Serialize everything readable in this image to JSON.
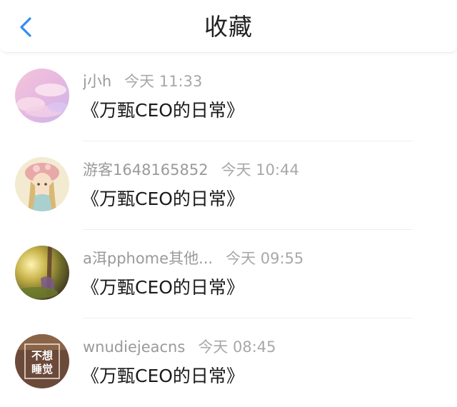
{
  "header": {
    "title": "收藏",
    "back_icon": "chevron-left-icon",
    "accent_color": "#2f8ff0"
  },
  "items": [
    {
      "name": "j小h",
      "time": "今天 11:33",
      "content": "《万甄CEO的日常》",
      "avatar": "pink-clouds-avatar"
    },
    {
      "name": "游客1648165852",
      "time": "今天 10:44",
      "content": "《万甄CEO的日常》",
      "avatar": "anime-girl-avatar"
    },
    {
      "name": "a洱pphome其他...",
      "time": "今天 09:55",
      "content": "《万甄CEO的日常》",
      "avatar": "forest-sunlight-avatar"
    },
    {
      "name": "wnudiejeacns",
      "time": "今天 08:45",
      "content": "《万甄CEO的日常》",
      "avatar": "text-avatar",
      "avatar_text_1": "不想",
      "avatar_text_2": "睡觉"
    }
  ]
}
